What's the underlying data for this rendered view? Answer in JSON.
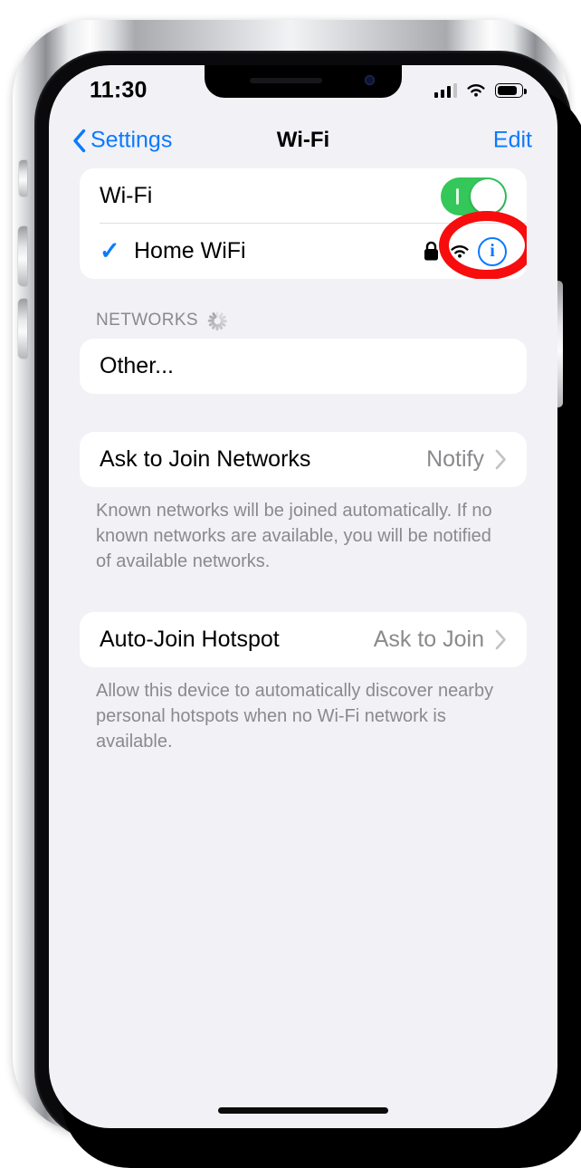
{
  "status_bar": {
    "time": "11:30",
    "cellular_icon": "cellular-bars-icon",
    "wifi_icon": "wifi-icon",
    "battery_icon": "battery-icon"
  },
  "nav_bar": {
    "back_label": "Settings",
    "back_icon": "chevron-left-icon",
    "title": "Wi-Fi",
    "edit_label": "Edit"
  },
  "wifi_section": {
    "toggle_label": "Wi-Fi",
    "toggle_state": "on",
    "network": {
      "name": "Home WiFi",
      "connected_icon": "checkmark-icon",
      "secured_icon": "lock-icon",
      "signal_icon": "wifi-signal-icon",
      "info_icon": "info-circle-icon"
    }
  },
  "networks_section": {
    "header": "NETWORKS",
    "spinner_icon": "activity-spinner-icon",
    "other_label": "Other..."
  },
  "ask_to_join": {
    "label": "Ask to Join Networks",
    "value": "Notify",
    "chevron_icon": "chevron-right-icon",
    "footer": "Known networks will be joined automatically. If no known networks are available, you will be notified of available networks."
  },
  "auto_join_hotspot": {
    "label": "Auto-Join Hotspot",
    "value": "Ask to Join",
    "chevron_icon": "chevron-right-icon",
    "footer": "Allow this device to automatically discover nearby personal hotspots when no Wi-Fi network is available."
  },
  "annotation": {
    "shape": "red-oval-highlight",
    "target": "network-info-button",
    "color": "#f70d0d"
  },
  "theme": {
    "accent_blue": "#0a7aff",
    "toggle_green": "#34c759",
    "background": "#f1f1f6",
    "card": "#ffffff",
    "secondary_text": "#8a8a8e"
  }
}
